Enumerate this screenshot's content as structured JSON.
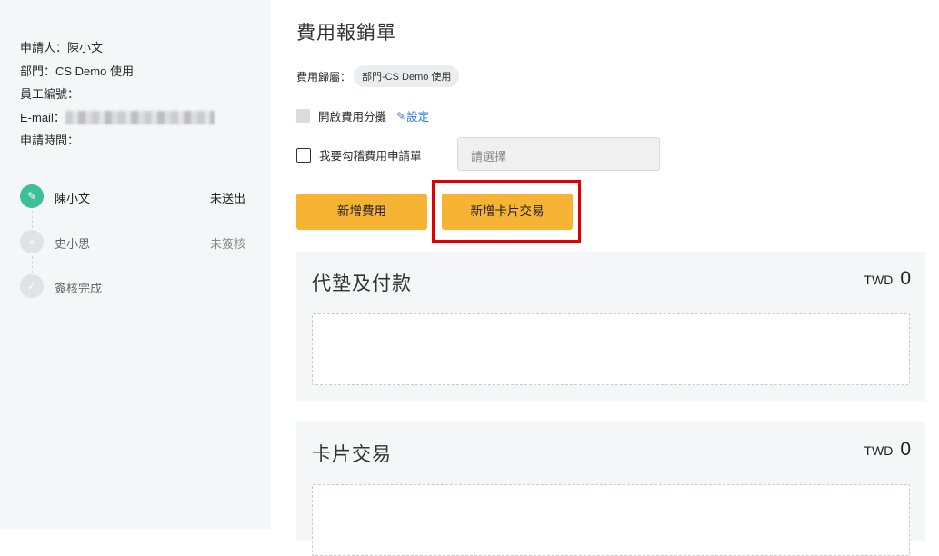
{
  "sidebar": {
    "info": {
      "applicant": "申請人：陳小文",
      "department": "部門：CS Demo 使用",
      "employee_id": "員工編號：",
      "email_label": "E-mail：",
      "apply_time": "申請時間："
    },
    "steps": [
      {
        "icon": "✎",
        "name": "陳小文",
        "status": "未送出"
      },
      {
        "icon": "»",
        "name": "史小思",
        "status": "未簽核"
      },
      {
        "icon": "✓",
        "name": "簽核完成",
        "status": ""
      }
    ]
  },
  "main": {
    "title": "費用報銷單",
    "dept_label": "費用歸屬：",
    "dept_value": "部門-CS Demo 使用",
    "split_label": "開啟費用分攤",
    "setting_label": "設定",
    "link_label": "我要勾稽費用申請單",
    "select_placeholder": "請選擇",
    "buttons": {
      "add_expense": "新增費用",
      "add_card_transaction": "新增卡片交易"
    },
    "sections": [
      {
        "title": "代墊及付款",
        "currency": "TWD",
        "amount": "0"
      },
      {
        "title": "卡片交易",
        "currency": "TWD",
        "amount": "0"
      }
    ]
  },
  "colors": {
    "accent": "#f7b334",
    "active_step": "#3dbf9a",
    "link": "#2b7bd6",
    "highlight": "#e00000"
  }
}
